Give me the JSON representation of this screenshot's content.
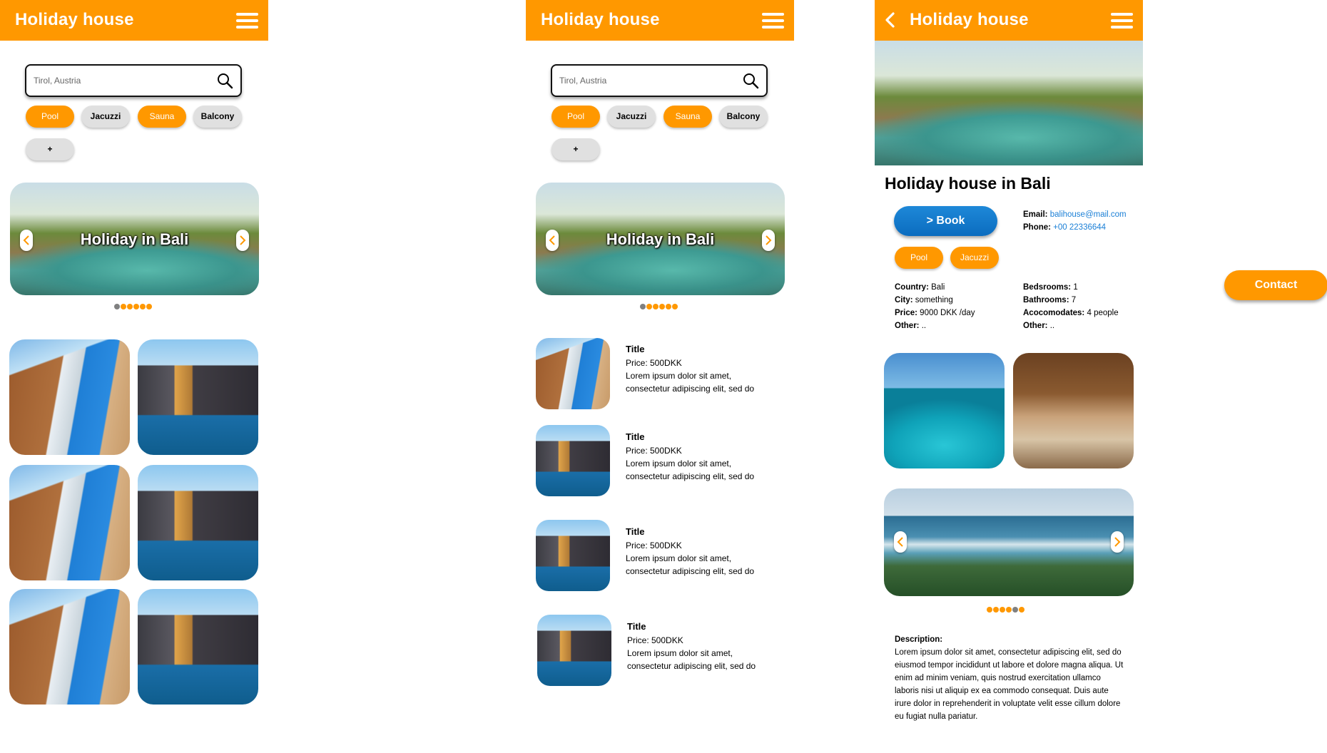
{
  "app": {
    "title": "Holiday house"
  },
  "search": {
    "value": "Tirol, Austria"
  },
  "filters": [
    "Pool",
    "Jacuzzi",
    "Sauna",
    "Balcony"
  ],
  "add_filter": "+",
  "banner": {
    "title": "Holiday in Bali",
    "dot_count": 6,
    "active_dot": 1
  },
  "list_items": [
    {
      "title": "Title",
      "price": "Price: 500DKK",
      "line1": "Lorem ipsum dolor sit amet,",
      "line2": "consectetur adipiscing elit, sed do"
    },
    {
      "title": "Title",
      "price": "Price: 500DKK",
      "line1": "Lorem ipsum dolor sit amet,",
      "line2": "consectetur adipiscing elit, sed do"
    },
    {
      "title": "Title",
      "price": "Price: 500DKK",
      "line1": "Lorem ipsum dolor sit amet,",
      "line2": "consectetur adipiscing elit, sed do"
    },
    {
      "title": "Title",
      "price": "Price: 500DKK",
      "line1": "Lorem ipsum dolor sit amet,",
      "line2": "consectetur adipiscing elit, sed do"
    }
  ],
  "detail": {
    "title": "Holiday house in Bali",
    "book_label": "> Book",
    "email_label": "Email:",
    "email": "balihouse@mail.com",
    "phone_label": "Phone:",
    "phone": "+00 22336644",
    "tags": [
      "Pool",
      "Jacuzzi"
    ],
    "country_label": "Country:",
    "country": "Bali",
    "city_label": "City:",
    "city": "something",
    "price_label": "Price:",
    "price": "9000 DKK /day",
    "other_label": "Other:",
    "other": "..",
    "bedrooms_label": "Bedsrooms:",
    "bedrooms": "1",
    "bathrooms_label": "Bathrooms:",
    "bathrooms": "7",
    "accommodates_label": "Acocomodates:",
    "accommodates": "4 people",
    "other2_label": "Other:",
    "other2": "..",
    "gallery_active_dot": 4,
    "description_label": "Description:",
    "description": "Lorem ipsum dolor sit amet, consectetur adipiscing elit, sed do eiusmod tempor incididunt ut labore et dolore magna aliqua. Ut enim ad minim veniam, quis nostrud exercitation ullamco laboris nisi ut aliquip ex ea commodo consequat. Duis aute irure dolor in reprehenderit in voluptate velit esse cillum dolore eu fugiat nulla pariatur."
  },
  "contact_label": "Contact",
  "colors": {
    "accent": "#ff9800",
    "book": "#0b6cbf",
    "chip_off": "#e0e0e0",
    "dot_inactive": "#808080"
  }
}
